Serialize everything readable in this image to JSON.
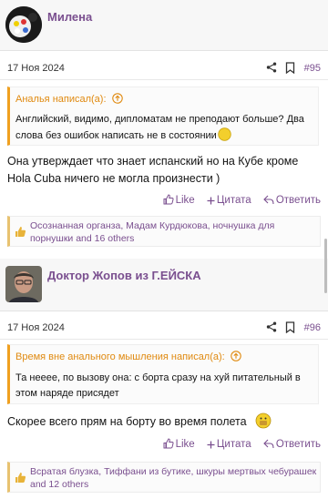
{
  "posts": [
    {
      "username": "Милена",
      "date": "17 Ноя 2024",
      "number": "#95",
      "quote_author": "Аналья написал(а):",
      "quote_text": "Английский, видимо, дипломатам не преподают больше? Два слова без ошибок написать не в состоянии",
      "message": "Она утверждает что знает испанский но на Кубе кроме Hola Cuba ничего не могла произнести )",
      "reactions": "Осознанная органза, Мадам Курдюкова, ночнушка для порнушки and 16 others"
    },
    {
      "username": "Доктор Жопов из Г.ЕЙСКА",
      "date": "17 Ноя 2024",
      "number": "#96",
      "quote_author": "Время вне анального мышления написал(а):",
      "quote_text": "Та нееее, по вызову она: с борта сразу на хуй питательный в этом наряде присядет",
      "message": "Скорее всего прям на борту во время полета",
      "reactions": "Всратая блузка, Тиффани из бутике, шкуры мертвых чебурашек and 12 others"
    }
  ],
  "actions": {
    "like": "Like",
    "quote": "Цитата",
    "reply": "Ответить"
  },
  "colors": {
    "accent": "#7a4f8f",
    "quote_accent": "#f0a020",
    "reaction_accent": "#e8c270"
  },
  "icons": [
    "share-icon",
    "bookmark-icon",
    "arrow-up-circle-icon",
    "thumbs-up-icon",
    "plus-icon",
    "reply-icon",
    "emoji-icon"
  ]
}
